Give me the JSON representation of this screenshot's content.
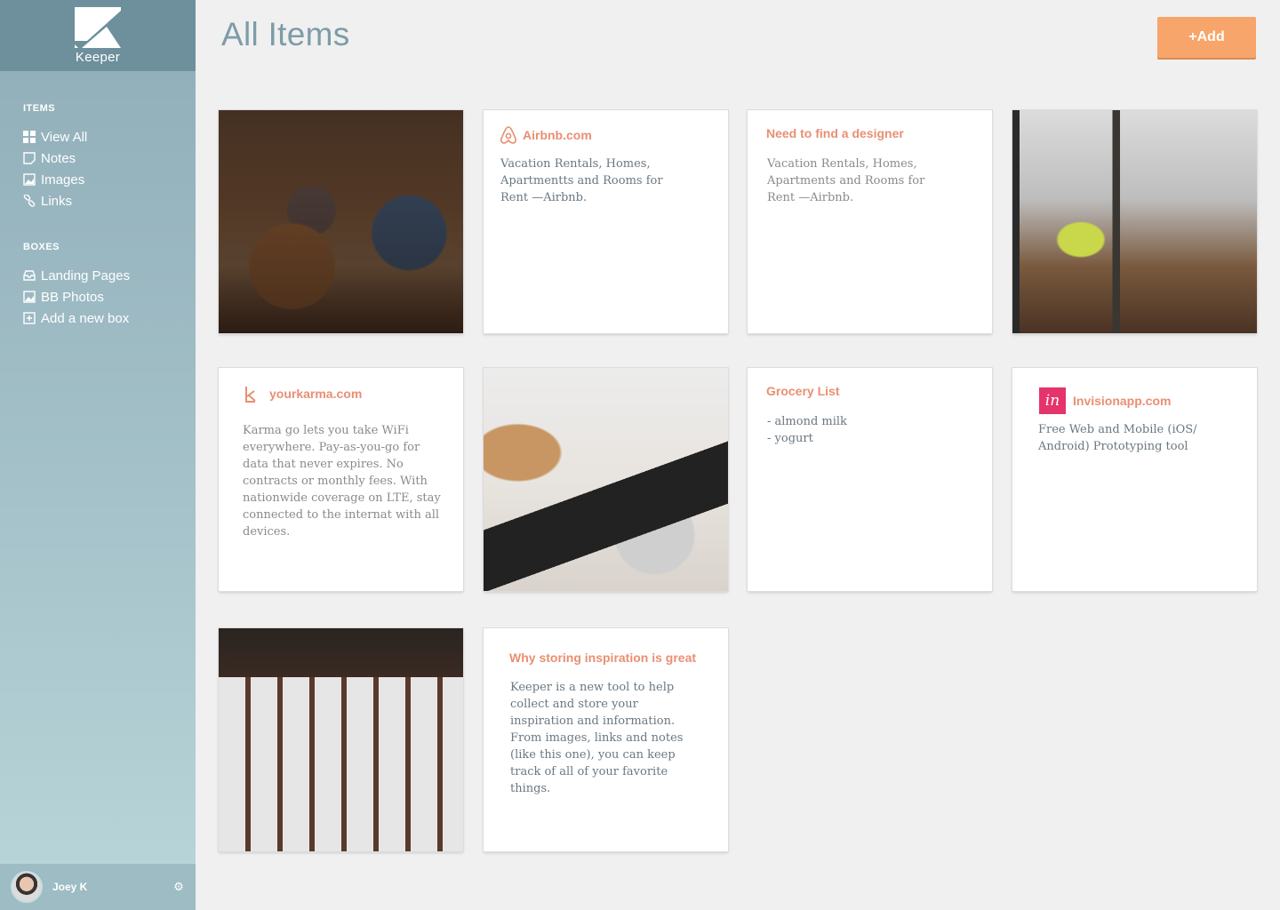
{
  "app": {
    "name": "Keeper"
  },
  "sidebar": {
    "items_heading": "ITEMS",
    "items": [
      {
        "label": "View All",
        "icon": "grid-icon"
      },
      {
        "label": "Notes",
        "icon": "note-icon"
      },
      {
        "label": "Images",
        "icon": "image-icon"
      },
      {
        "label": "Links",
        "icon": "link-icon"
      }
    ],
    "boxes_heading": "BOXES",
    "boxes": [
      {
        "label": "Landing Pages",
        "icon": "inbox-icon"
      },
      {
        "label": "BB Photos",
        "icon": "image-icon"
      },
      {
        "label": "Add a new box",
        "icon": "plus-box-icon"
      }
    ],
    "user": {
      "name": "Joey K"
    }
  },
  "header": {
    "title": "All Items",
    "add_label": "+Add"
  },
  "cards": {
    "airbnb": {
      "title": "Airbnb.com",
      "body": "Vacation Rentals, Homes, Apartmentts and Rooms for Rent —Airbnb."
    },
    "designer": {
      "title": "Need to find a designer",
      "body": "Vacation Rentals, Homes, Apartments and Rooms for Rent —Airbnb."
    },
    "karma": {
      "title": "yourkarma.com",
      "body": "Karma go lets you take WiFi everywhere. Pay-as-you-go for data that never expires. No contracts or monthly fees. With nationwide coverage on LTE, stay connected to the internat with all devices."
    },
    "grocery": {
      "title": "Grocery List",
      "line1": "- almond milk",
      "line2": "- yogurt"
    },
    "invision": {
      "title": "Invisionapp.com",
      "logo_text": "in",
      "body": "Free Web and Mobile (iOS/ Android) Prototyping tool"
    },
    "inspiration": {
      "title": "Why storing inspiration is great",
      "body": "Keeper is a new tool to help collect and store your inspiration and information. From images, links and notes (like this one), you can keep track of all of your favorite things."
    }
  },
  "colors": {
    "accent": "#e98f73",
    "add_button": "#f7a56a",
    "sidebar": "#8fadb8",
    "invision_brand": "#e5336b"
  }
}
